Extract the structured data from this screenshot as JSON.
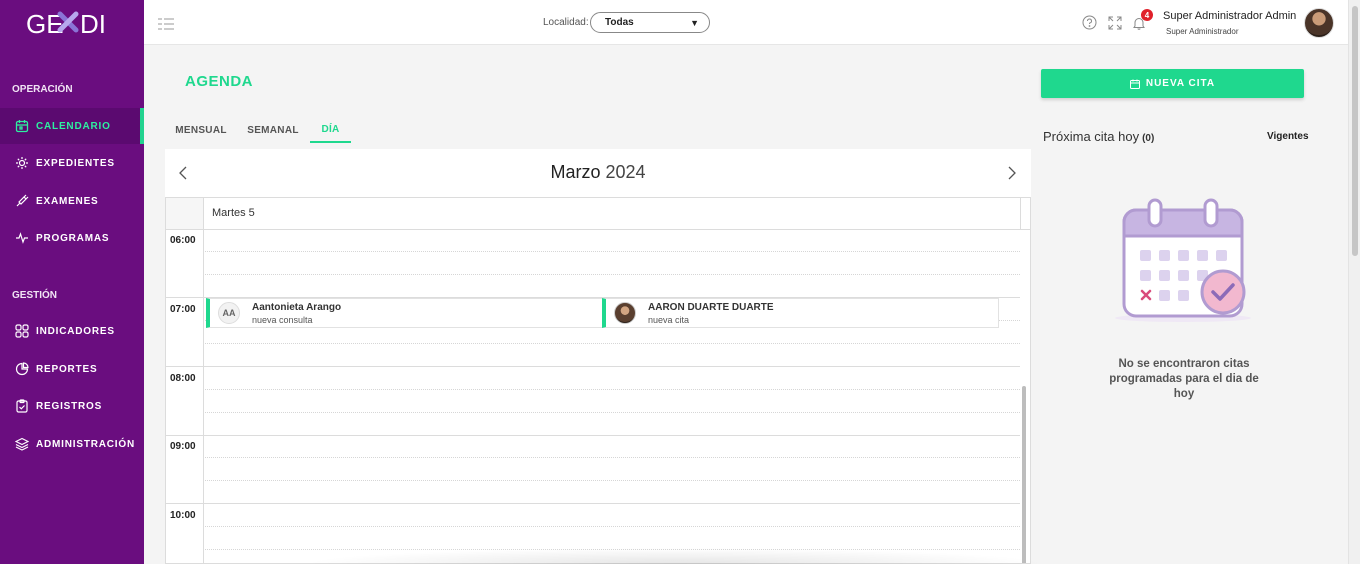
{
  "brand": {
    "logo_text": "GEXDI",
    "accent": "#1fd88e",
    "sidebar_bg": "#6a0d7f"
  },
  "sidebar": {
    "sections": [
      {
        "label": "OPERACIÓN"
      },
      {
        "label": "GESTIÓN"
      }
    ],
    "items": [
      {
        "label": "CALENDARIO",
        "icon": "calendar-icon",
        "active": true
      },
      {
        "label": "EXPEDIENTES",
        "icon": "gear-icon"
      },
      {
        "label": "EXAMENES",
        "icon": "syringe-icon"
      },
      {
        "label": "PROGRAMAS",
        "icon": "pulse-icon"
      },
      {
        "label": "INDICADORES",
        "icon": "grid-icon"
      },
      {
        "label": "REPORTES",
        "icon": "pie-chart-icon"
      },
      {
        "label": "REGISTROS",
        "icon": "clipboard-icon"
      },
      {
        "label": "ADMINISTRACIÓN",
        "icon": "layers-icon"
      }
    ]
  },
  "header": {
    "location_label": "Localidad:",
    "location_value": "Todas",
    "notifications_count": "4",
    "user_name": "Super Administrador Admin",
    "user_role": "Super Administrador"
  },
  "agenda": {
    "title": "AGENDA",
    "tabs": [
      {
        "label": "MENSUAL"
      },
      {
        "label": "SEMANAL"
      },
      {
        "label": "DÍA",
        "active": true
      }
    ],
    "month": "Marzo",
    "year": "2024",
    "day_label": "Martes 5",
    "hours": [
      "06:00",
      "07:00",
      "08:00",
      "09:00",
      "10:00"
    ],
    "events": [
      {
        "initials": "AA",
        "name": "Aantonieta Arango",
        "type": "nueva consulta"
      },
      {
        "initials": "",
        "name": "AARON DUARTE DUARTE",
        "type": "nueva cita"
      }
    ]
  },
  "right_panel": {
    "new_button": "NUEVA CITA",
    "next_title": "Próxima cita hoy",
    "next_count": "(0)",
    "filter": "Vigentes",
    "empty_message": "No se encontraron citas programadas para el dia de hoy"
  }
}
